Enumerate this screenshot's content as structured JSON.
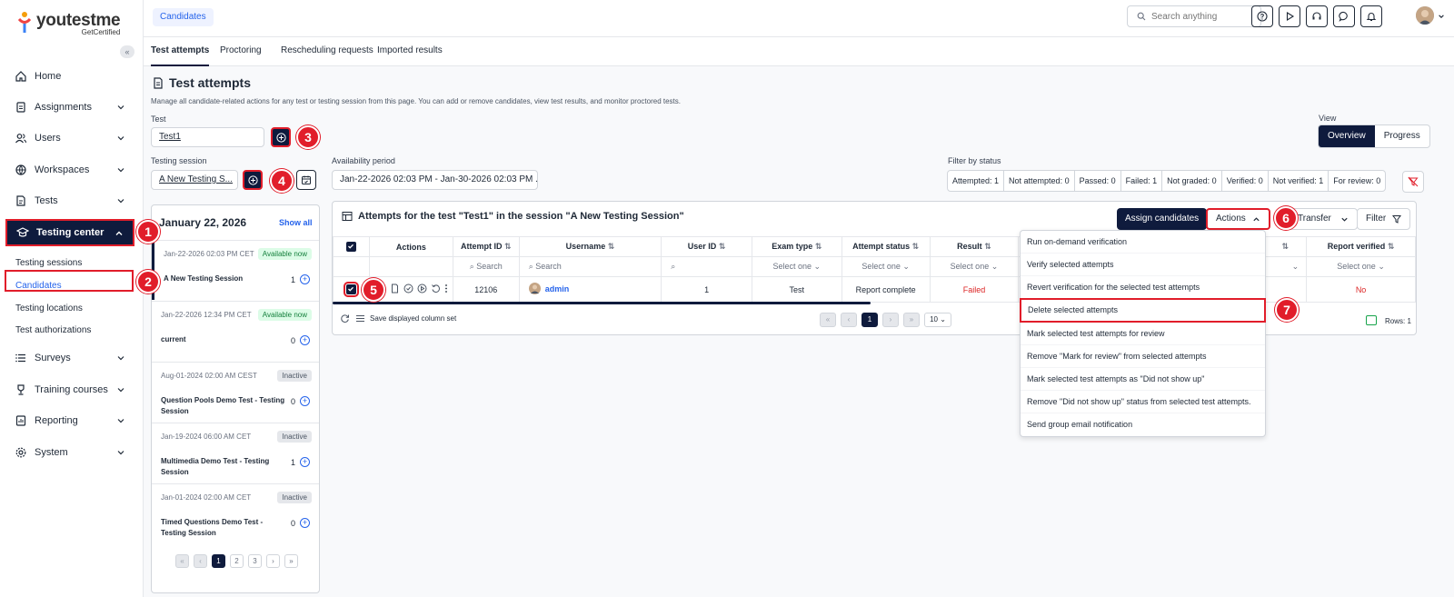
{
  "brand": {
    "name": "youtestme",
    "tagline": "GetCertified"
  },
  "sidebar": {
    "items": [
      {
        "label": "Home",
        "icon": "home-icon"
      },
      {
        "label": "Assignments",
        "icon": "clipboard-icon"
      },
      {
        "label": "Users",
        "icon": "users-icon"
      },
      {
        "label": "Workspaces",
        "icon": "globe-icon"
      },
      {
        "label": "Tests",
        "icon": "document-icon"
      },
      {
        "label": "Testing center",
        "icon": "graduation-cap-icon"
      },
      {
        "label": "Surveys",
        "icon": "list-icon"
      },
      {
        "label": "Training courses",
        "icon": "trophy-icon"
      },
      {
        "label": "Reporting",
        "icon": "report-icon"
      },
      {
        "label": "System",
        "icon": "gear-icon"
      }
    ],
    "sub_items": [
      "Testing sessions",
      "Candidates",
      "Testing locations",
      "Test authorizations"
    ]
  },
  "topbar": {
    "breadcrumb": "Candidates",
    "search_placeholder": "Search anything"
  },
  "tabs": [
    "Test attempts",
    "Proctoring",
    "Rescheduling requests",
    "Imported results"
  ],
  "page": {
    "title": "Test attempts",
    "description": "Manage all candidate-related actions for any test or testing session from this page. You can add or remove candidates, view test results, and monitor proctored tests.",
    "test_label": "Test",
    "test_value": "Test1",
    "session_label": "Testing session",
    "session_value": "A New Testing S...",
    "availability_label": "Availability period",
    "availability_value": "Jan-22-2026 02:03 PM - Jan-30-2026 02:03 PM ...",
    "view_label": "View",
    "view_options": [
      "Overview",
      "Progress"
    ],
    "filter_status_label": "Filter by status",
    "status_filters": [
      "Attempted: 1",
      "Not attempted: 0",
      "Passed: 0",
      "Failed: 1",
      "Not graded: 0",
      "Verified: 0",
      "Not verified: 1",
      "For review: 0"
    ]
  },
  "sessions": {
    "date": "January 22, 2026",
    "show_all": "Show all",
    "cards": [
      {
        "time": "Jan-22-2026 02:03 PM CET",
        "tag": "Available now",
        "name": "A New Testing Session",
        "count": "1"
      },
      {
        "time": "Jan-22-2026 12:34 PM CET",
        "tag": "Available now",
        "name": "current",
        "count": "0"
      },
      {
        "time": "Aug-01-2024 02:00 AM CEST",
        "tag": "Inactive",
        "name": "Question Pools Demo Test - Testing Session",
        "count": "0"
      },
      {
        "time": "Jan-19-2024 06:00 AM CET",
        "tag": "Inactive",
        "name": "Multimedia Demo Test - Testing Session",
        "count": "1"
      },
      {
        "time": "Jan-01-2024 02:00 AM CET",
        "tag": "Inactive",
        "name": "Timed Questions Demo Test - Testing Session",
        "count": "0"
      }
    ],
    "pages": [
      "1",
      "2",
      "3"
    ]
  },
  "attempts": {
    "title": "Attempts for the test \"Test1\" in the session \"A New Testing Session\"",
    "assign_label": "Assign candidates",
    "actions_label": "Actions",
    "transfer_label": "Transfer",
    "filter_label": "Filter",
    "columns": [
      "Actions",
      "Attempt ID",
      "Username",
      "User ID",
      "Exam type",
      "Attempt status",
      "Result",
      "Report verified"
    ],
    "filters": {
      "search": "Search",
      "select": "Select one"
    },
    "row": {
      "attempt_id": "12106",
      "username": "admin",
      "user_id": "1",
      "exam_type": "Test",
      "status": "Report complete",
      "result": "Failed",
      "verified": "No"
    },
    "footer_save": "Save displayed column set",
    "page": "1",
    "page_size": "10",
    "rows": "Rows: 1"
  },
  "actions_menu": [
    "Run on-demand verification",
    "Verify selected attempts",
    "Revert verification for the selected test attempts",
    "Delete selected attempts",
    "Mark selected test attempts for review",
    "Remove \"Mark for review\" from selected attempts",
    "Mark selected test attempts as \"Did not show up\"",
    "Remove \"Did not show up\" status from selected test attempts.",
    "Send group email notification"
  ],
  "callouts": [
    "1",
    "2",
    "3",
    "4",
    "5",
    "6",
    "7"
  ],
  "colors": {
    "navy": "#0f1b3d",
    "highlight": "#e11d2a",
    "link": "#2563eb",
    "failed": "#dc2626"
  }
}
